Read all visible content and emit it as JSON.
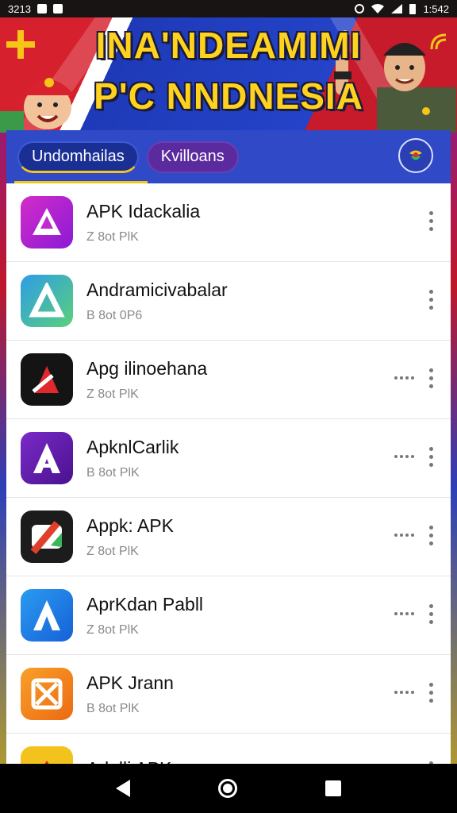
{
  "status_bar": {
    "time_left": "3213",
    "time_right": "1:542"
  },
  "banner": {
    "title_line1": "INA'NDEAMIMI",
    "title_line2": "P'C NNDNESIA"
  },
  "tabs": [
    {
      "label": "Undomhailas",
      "active": true
    },
    {
      "label": "Kvilloans",
      "active": false
    }
  ],
  "apps": [
    {
      "name": "APK Idackalia",
      "meta": "Z 8ot PlK",
      "icon": "pink-a-icon",
      "color": "#c02ad0",
      "menu": "vertical"
    },
    {
      "name": "Andramicivabalar",
      "meta": "B 8ot 0P6",
      "icon": "gradient-a-icon",
      "color": "#2e9de6",
      "menu": "vertical"
    },
    {
      "name": "Apg ilinoehana",
      "meta": "Z 8ot PlK",
      "icon": "dark-a-icon",
      "color": "#141414",
      "menu": "both"
    },
    {
      "name": "ApknlCarlik",
      "meta": "B 8ot PlK",
      "icon": "purple-a-icon",
      "color": "#6a22b5",
      "menu": "both"
    },
    {
      "name": "Appk: APK",
      "meta": "Z 8ot PlK",
      "icon": "camera-a-icon",
      "color": "#1c1c1c",
      "menu": "both"
    },
    {
      "name": "AprKdan Pabll",
      "meta": "Z 8ot PlK",
      "icon": "blue-a-icon",
      "color": "#1f86e8",
      "menu": "both"
    },
    {
      "name": "APK Jrann",
      "meta": "B 8ot PlK",
      "icon": "orange-x-icon",
      "color": "#f08a1c",
      "menu": "both"
    },
    {
      "name": "Adalli APK",
      "meta": "",
      "icon": "yellow-icon",
      "color": "#f4c21c",
      "menu": "vertical"
    }
  ]
}
